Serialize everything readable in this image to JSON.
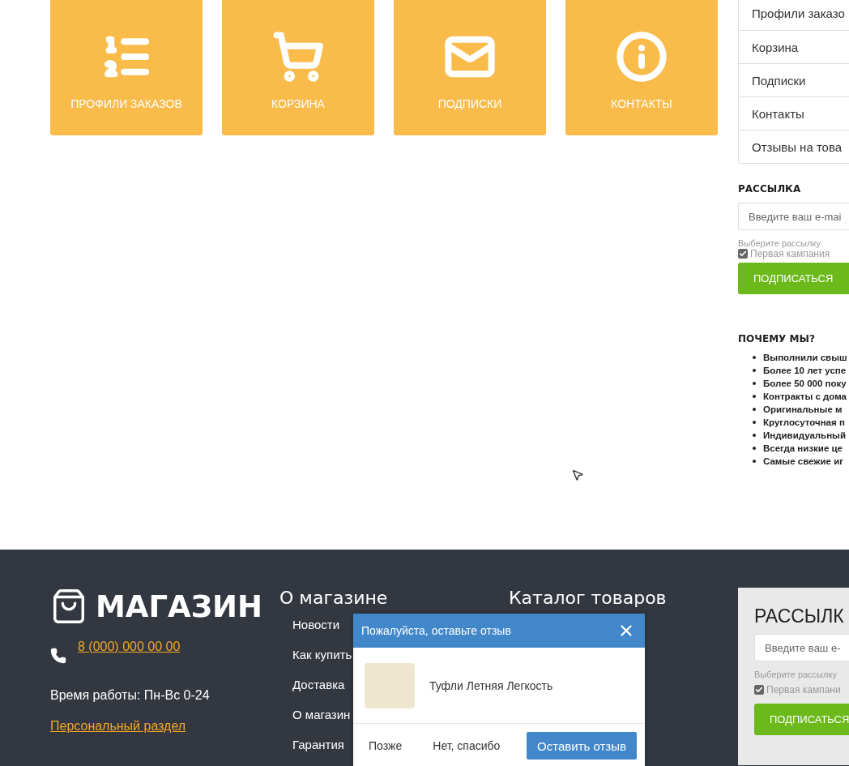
{
  "tiles": [
    {
      "label": "ПРОФИЛИ ЗАКАЗОВ",
      "kind": "list"
    },
    {
      "label": "КОРЗИНА",
      "kind": "cart"
    },
    {
      "label": "ПОДПИСКИ",
      "kind": "mail"
    },
    {
      "label": "КОНТАКТЫ",
      "kind": "info"
    }
  ],
  "side_menu": {
    "items": [
      "Профили заказо",
      "Корзина",
      "Подписки",
      "Контакты",
      "Отзывы на това"
    ]
  },
  "subscribe": {
    "title": "РАССЫЛКА",
    "placeholder": "Введите ваш e-mai",
    "hint": "Выберите рассылку",
    "options": [
      {
        "label": "Первая кампания",
        "checked": true
      }
    ],
    "button": "ПОДПИСАТЬСЯ"
  },
  "why": {
    "title": "ПОЧЕМУ МЫ?",
    "items": [
      "Выполнили свыш",
      "Более 10 лет успе",
      "Более 50 000 поку",
      "Контракты с дома",
      "Оригинальные м",
      "Круглосуточная п",
      "Индивидуальный",
      "Всегда низкие це",
      "Самые свежие иг"
    ]
  },
  "footer": {
    "logo": "МАГАЗИН",
    "phone": "8 (000) 000 00 00",
    "hours": "Время работы: Пн-Вс 0-24",
    "personal_link": "Персональный раздел",
    "columns": [
      {
        "title": "О магазине",
        "links": [
          "Новости",
          "Как купить",
          "Доставка",
          "О магазин",
          "Гарантия"
        ]
      },
      {
        "title": "Каталог товаров"
      }
    ],
    "subscribe": {
      "title": "РАССЫЛК",
      "placeholder": "Введите ваш e-",
      "hint": "Выберите рассылку",
      "options": [
        {
          "label": "Первая кампани",
          "checked": true
        }
      ],
      "button": "ПОДПИСАТЬСЯ"
    }
  },
  "review_popup": {
    "title": "Пожалуйста, оставьте отзыв",
    "product": "Туфли Летняя Легкость",
    "buttons": [
      {
        "label": "Позже",
        "kind": "plain"
      },
      {
        "label": "Нет, спасибо",
        "kind": "plain"
      },
      {
        "label": "Оставить отзыв",
        "kind": "primary"
      }
    ]
  }
}
